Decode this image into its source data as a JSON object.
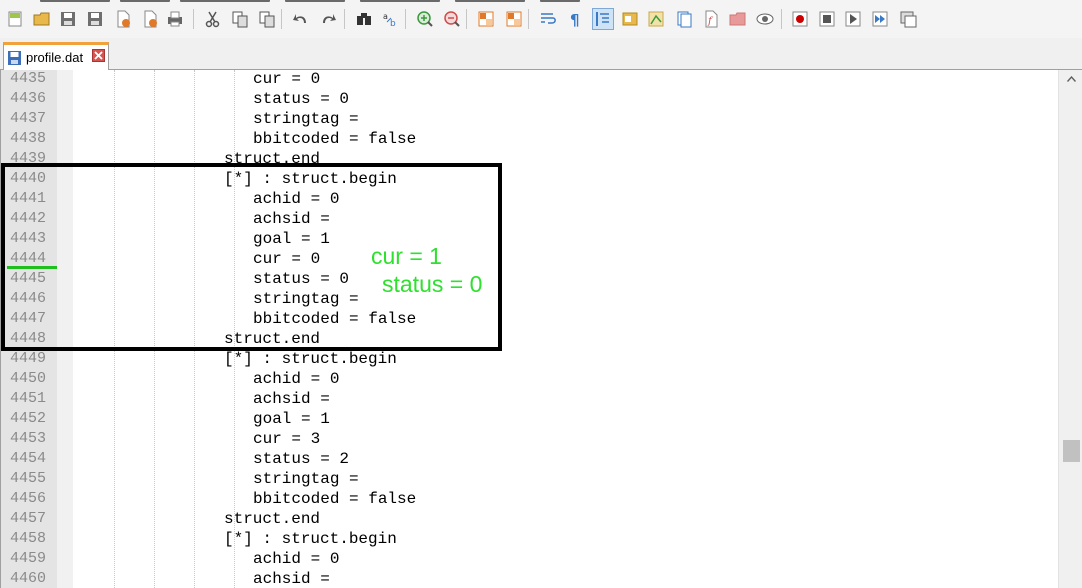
{
  "app": {
    "tab": {
      "title": "profile.dat"
    }
  },
  "toolbar": {
    "buttons": [
      {
        "name": "new-file-icon",
        "color": "#9ec64b"
      },
      {
        "name": "open-file-icon",
        "color": "#e8b84a"
      },
      {
        "name": "save-icon",
        "color": "#6f6f6f"
      },
      {
        "name": "save-all-icon",
        "color": "#6f6f6f"
      },
      {
        "name": "close-icon",
        "color": "#e07a2a"
      },
      {
        "name": "close-all-icon",
        "color": "#e07a2a"
      },
      {
        "name": "print-icon",
        "color": "#666666"
      },
      {
        "name": "cut-icon",
        "color": "#555555"
      },
      {
        "name": "copy-icon",
        "color": "#555555"
      },
      {
        "name": "paste-icon",
        "color": "#555555"
      },
      {
        "name": "undo-icon",
        "color": "#555555"
      },
      {
        "name": "redo-icon",
        "color": "#555555"
      },
      {
        "name": "find-icon",
        "color": "#333333"
      },
      {
        "name": "replace-icon",
        "color": "#3a79c6"
      },
      {
        "name": "zoom-in-icon",
        "color": "#3a9a3a"
      },
      {
        "name": "zoom-out-icon",
        "color": "#d04a4a"
      },
      {
        "name": "sync-vertical-icon",
        "color": "#e07a2a"
      },
      {
        "name": "sync-horizontal-icon",
        "color": "#e07a2a"
      },
      {
        "name": "word-wrap-icon",
        "color": "#3a79c6"
      },
      {
        "name": "show-all-characters-icon",
        "color": "#3a79c6"
      },
      {
        "name": "indent-guide-icon",
        "color": "#3a79c6"
      },
      {
        "name": "user-language-icon",
        "color": "#e8b84a"
      },
      {
        "name": "document-map-icon",
        "color": "#caa84a"
      },
      {
        "name": "document-list-icon",
        "color": "#3a79c6"
      },
      {
        "name": "function-list-icon",
        "color": "#d04a4a"
      },
      {
        "name": "folder-workspace-icon",
        "color": "#e89a9a"
      },
      {
        "name": "monitoring-icon",
        "color": "#666666"
      },
      {
        "name": "record-macro-icon",
        "color": "#cc0000"
      },
      {
        "name": "stop-recording-icon",
        "color": "#555555"
      },
      {
        "name": "playback-macro-icon",
        "color": "#555555"
      },
      {
        "name": "run-macro-multiple-icon",
        "color": "#3a79c6"
      },
      {
        "name": "save-macro-icon",
        "color": "#666666"
      }
    ]
  },
  "editor": {
    "lines": [
      {
        "num": "4435",
        "text": "cur = 0",
        "indent": 2
      },
      {
        "num": "4436",
        "text": "status = 0",
        "indent": 2
      },
      {
        "num": "4437",
        "text": "stringtag =",
        "indent": 2
      },
      {
        "num": "4438",
        "text": "bbitcoded = false",
        "indent": 2
      },
      {
        "num": "4439",
        "text": "struct.end",
        "indent": 1
      },
      {
        "num": "4440",
        "text": "[*] : struct.begin",
        "indent": 1
      },
      {
        "num": "4441",
        "text": "achid = 0",
        "indent": 2
      },
      {
        "num": "4442",
        "text": "achsid =",
        "indent": 2
      },
      {
        "num": "4443",
        "text": "goal = 1",
        "indent": 2
      },
      {
        "num": "4444",
        "text": "cur = 0",
        "indent": 2
      },
      {
        "num": "4445",
        "text": "status = 0",
        "indent": 2
      },
      {
        "num": "4446",
        "text": "stringtag =",
        "indent": 2
      },
      {
        "num": "4447",
        "text": "bbitcoded = false",
        "indent": 2
      },
      {
        "num": "4448",
        "text": "struct.end",
        "indent": 1
      },
      {
        "num": "4449",
        "text": "[*] : struct.begin",
        "indent": 1
      },
      {
        "num": "4450",
        "text": "achid = 0",
        "indent": 2
      },
      {
        "num": "4451",
        "text": "achsid =",
        "indent": 2
      },
      {
        "num": "4452",
        "text": "goal = 1",
        "indent": 2
      },
      {
        "num": "4453",
        "text": "cur = 3",
        "indent": 2
      },
      {
        "num": "4454",
        "text": "status = 2",
        "indent": 2
      },
      {
        "num": "4455",
        "text": "stringtag =",
        "indent": 2
      },
      {
        "num": "4456",
        "text": "bbitcoded = false",
        "indent": 2
      },
      {
        "num": "4457",
        "text": "struct.end",
        "indent": 1
      },
      {
        "num": "4458",
        "text": "[*] : struct.begin",
        "indent": 1
      },
      {
        "num": "4459",
        "text": "achid = 0",
        "indent": 2
      },
      {
        "num": "4460",
        "text": "achsid =",
        "indent": 2
      }
    ]
  },
  "annotation": {
    "line1": "cur = 1",
    "line2": "status = 0",
    "color": "#2fe02f",
    "box_color": "#000000"
  },
  "colors": {
    "tab_accent": "#f2a23a",
    "gutter_bg": "#e4e4e4",
    "line_number": "#8a8a8a",
    "marker": "#1fbf1f"
  }
}
